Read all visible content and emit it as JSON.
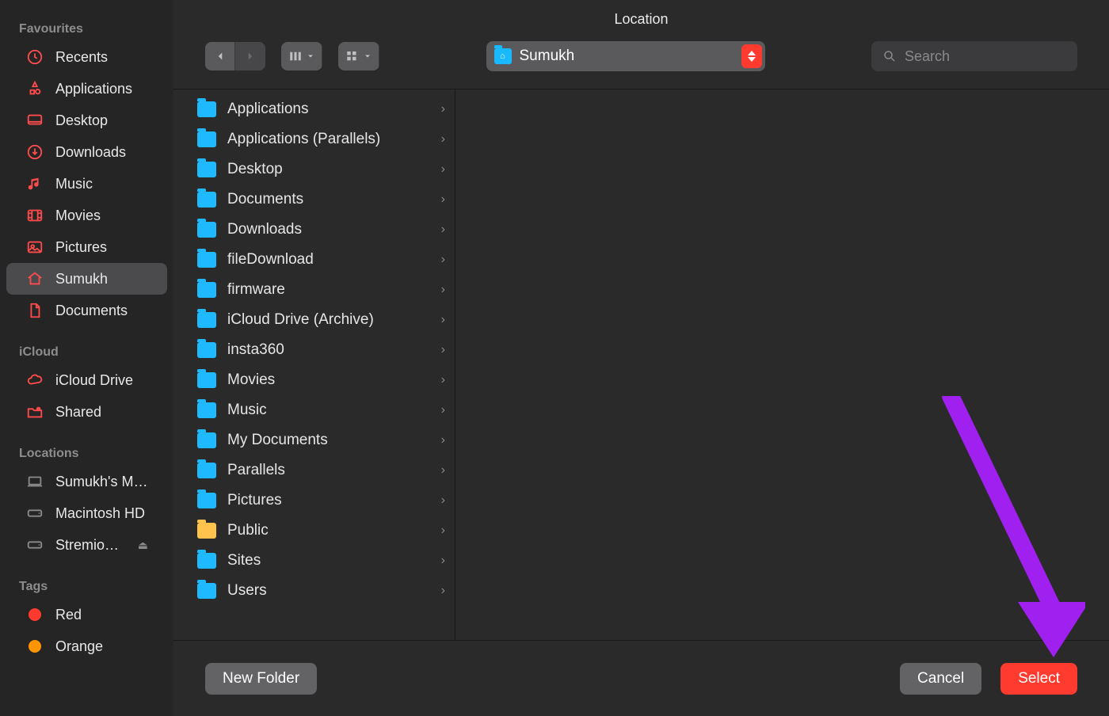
{
  "title": "Location",
  "search_placeholder": "Search",
  "path": {
    "label": "Sumukh"
  },
  "sidebar": {
    "sections": [
      {
        "header": "Favourites",
        "items": [
          {
            "icon": "clock",
            "label": "Recents"
          },
          {
            "icon": "apps",
            "label": "Applications"
          },
          {
            "icon": "desktop",
            "label": "Desktop"
          },
          {
            "icon": "download",
            "label": "Downloads"
          },
          {
            "icon": "music",
            "label": "Music"
          },
          {
            "icon": "movies",
            "label": "Movies"
          },
          {
            "icon": "pictures",
            "label": "Pictures"
          },
          {
            "icon": "home",
            "label": "Sumukh",
            "selected": true
          },
          {
            "icon": "document",
            "label": "Documents"
          }
        ]
      },
      {
        "header": "iCloud",
        "items": [
          {
            "icon": "cloud",
            "label": "iCloud Drive"
          },
          {
            "icon": "shared",
            "label": "Shared"
          }
        ]
      },
      {
        "header": "Locations",
        "items": [
          {
            "icon": "laptop",
            "label": "Sumukh's M…"
          },
          {
            "icon": "hdd",
            "label": "Macintosh HD"
          },
          {
            "icon": "extdisk",
            "label": "Stremio…",
            "ejectable": true
          }
        ]
      },
      {
        "header": "Tags",
        "items": [
          {
            "icon": "tag",
            "color": "#ff3b30",
            "label": "Red"
          },
          {
            "icon": "tag",
            "color": "#ff9500",
            "label": "Orange"
          }
        ]
      }
    ]
  },
  "folders": [
    {
      "label": "Applications"
    },
    {
      "label": "Applications (Parallels)"
    },
    {
      "label": "Desktop"
    },
    {
      "label": "Documents"
    },
    {
      "label": "Downloads"
    },
    {
      "label": "fileDownload"
    },
    {
      "label": "firmware"
    },
    {
      "label": "iCloud Drive (Archive)"
    },
    {
      "label": "insta360"
    },
    {
      "label": "Movies"
    },
    {
      "label": "Music"
    },
    {
      "label": "My Documents"
    },
    {
      "label": "Parallels"
    },
    {
      "label": "Pictures"
    },
    {
      "label": "Public",
      "orange": true
    },
    {
      "label": "Sites"
    },
    {
      "label": "Users"
    }
  ],
  "buttons": {
    "new_folder": "New Folder",
    "cancel": "Cancel",
    "select": "Select"
  }
}
